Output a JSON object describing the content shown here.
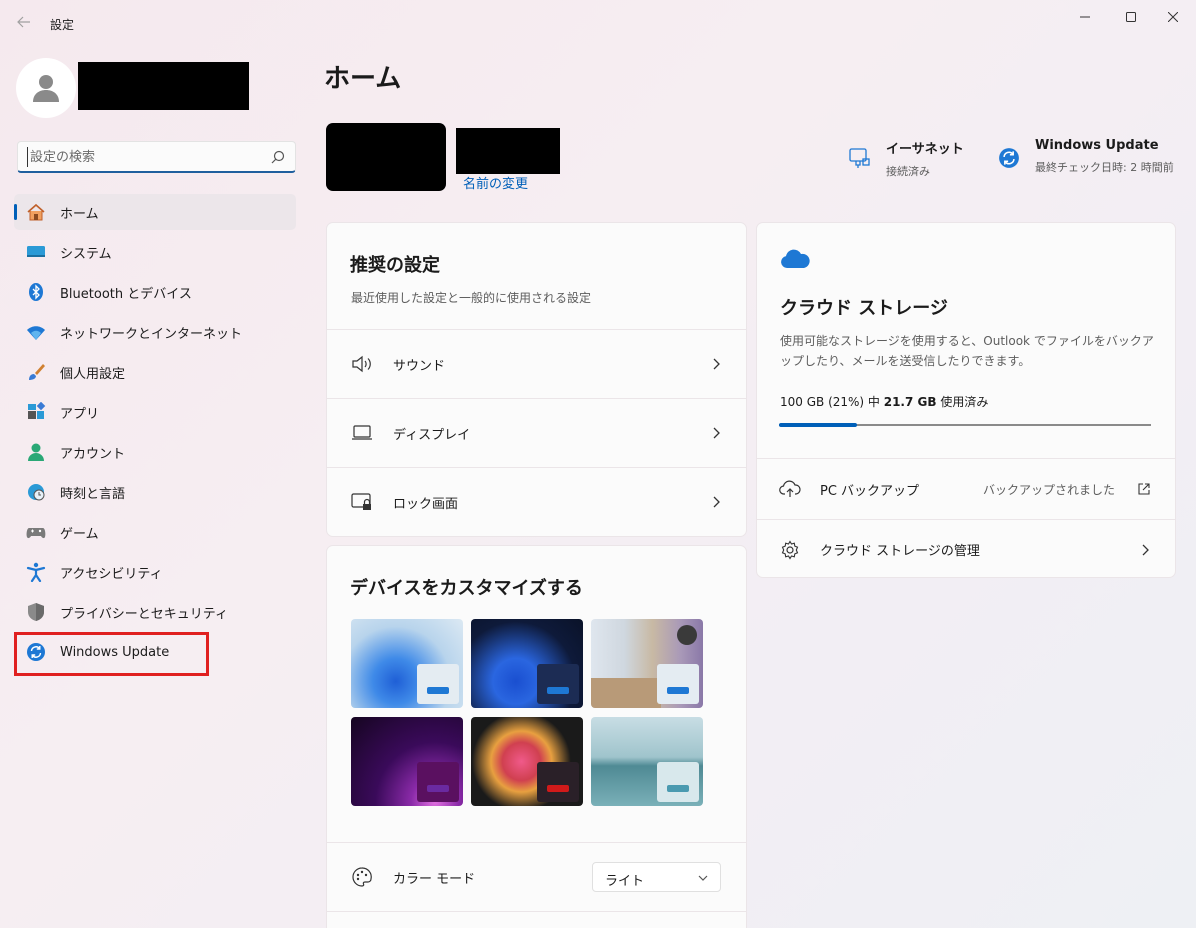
{
  "window": {
    "title": "設定"
  },
  "search": {
    "placeholder": "設定の検索",
    "value": ""
  },
  "sidebar": {
    "items": [
      {
        "label": "ホーム",
        "icon": "home-icon",
        "active": true
      },
      {
        "label": "システム",
        "icon": "system-icon"
      },
      {
        "label": "Bluetooth とデバイス",
        "icon": "bluetooth-icon"
      },
      {
        "label": "ネットワークとインターネット",
        "icon": "wifi-icon"
      },
      {
        "label": "個人用設定",
        "icon": "brush-icon"
      },
      {
        "label": "アプリ",
        "icon": "apps-icon"
      },
      {
        "label": "アカウント",
        "icon": "account-icon"
      },
      {
        "label": "時刻と言語",
        "icon": "clock-globe-icon"
      },
      {
        "label": "ゲーム",
        "icon": "gamepad-icon"
      },
      {
        "label": "アクセシビリティ",
        "icon": "accessibility-icon"
      },
      {
        "label": "プライバシーとセキュリティ",
        "icon": "shield-icon"
      },
      {
        "label": "Windows Update",
        "icon": "windows-update-icon"
      }
    ]
  },
  "main": {
    "title": "ホーム",
    "rename_link": "名前の変更",
    "status": {
      "network": {
        "title": "イーサネット",
        "sub": "接続済み"
      },
      "update": {
        "title": "Windows Update",
        "sub": "最終チェック日時: 2 時間前"
      }
    }
  },
  "recommended": {
    "title": "推奨の設定",
    "subtitle": "最近使用した設定と一般的に使用される設定",
    "rows": [
      {
        "label": "サウンド",
        "icon": "speaker-icon"
      },
      {
        "label": "ディスプレイ",
        "icon": "laptop-icon"
      },
      {
        "label": "ロック画面",
        "icon": "lock-screen-icon"
      }
    ]
  },
  "cloud": {
    "title": "クラウド ストレージ",
    "description": "使用可能なストレージを使用すると、Outlook でファイルをバックアップしたり、メールを送受信したりできます。",
    "usage_prefix": "100 GB (21%) 中 ",
    "usage_bold": "21.7 GB",
    "usage_suffix": " 使用済み",
    "usage_fraction": 0.21,
    "rows": [
      {
        "label": "PC バックアップ",
        "status": "バックアップされました"
      },
      {
        "label": "クラウド ストレージの管理"
      }
    ]
  },
  "customize": {
    "title": "デバイスをカスタマイズする",
    "color_mode_label": "カラー モード",
    "color_mode_value": "ライト"
  },
  "colors": {
    "accent": "#005fb8",
    "highlight": "#e02020"
  }
}
